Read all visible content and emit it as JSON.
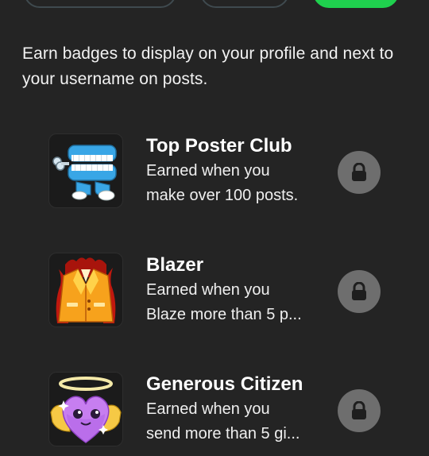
{
  "intro": {
    "text": "Earn badges to display on your profile and next to your username on posts."
  },
  "colors": {
    "background": "#242424",
    "accent_green": "#1fd04e",
    "lock_circle": "#6e6e6e"
  },
  "badges": [
    {
      "title": "Top Poster Club",
      "desc_line1": "Earned when you",
      "desc_line2": "make over 100 posts.",
      "icon": "wind-up-teeth-icon",
      "status_icon": "lock-icon"
    },
    {
      "title": "Blazer",
      "desc_line1": "Earned when you",
      "desc_line2": "Blaze more than 5 p...",
      "icon": "flaming-blazer-icon",
      "status_icon": "lock-icon"
    },
    {
      "title": "Generous Citizen",
      "desc_line1": "Earned when you",
      "desc_line2": "send more than 5 gi...",
      "icon": "angel-heart-icon",
      "status_icon": "lock-icon"
    }
  ]
}
